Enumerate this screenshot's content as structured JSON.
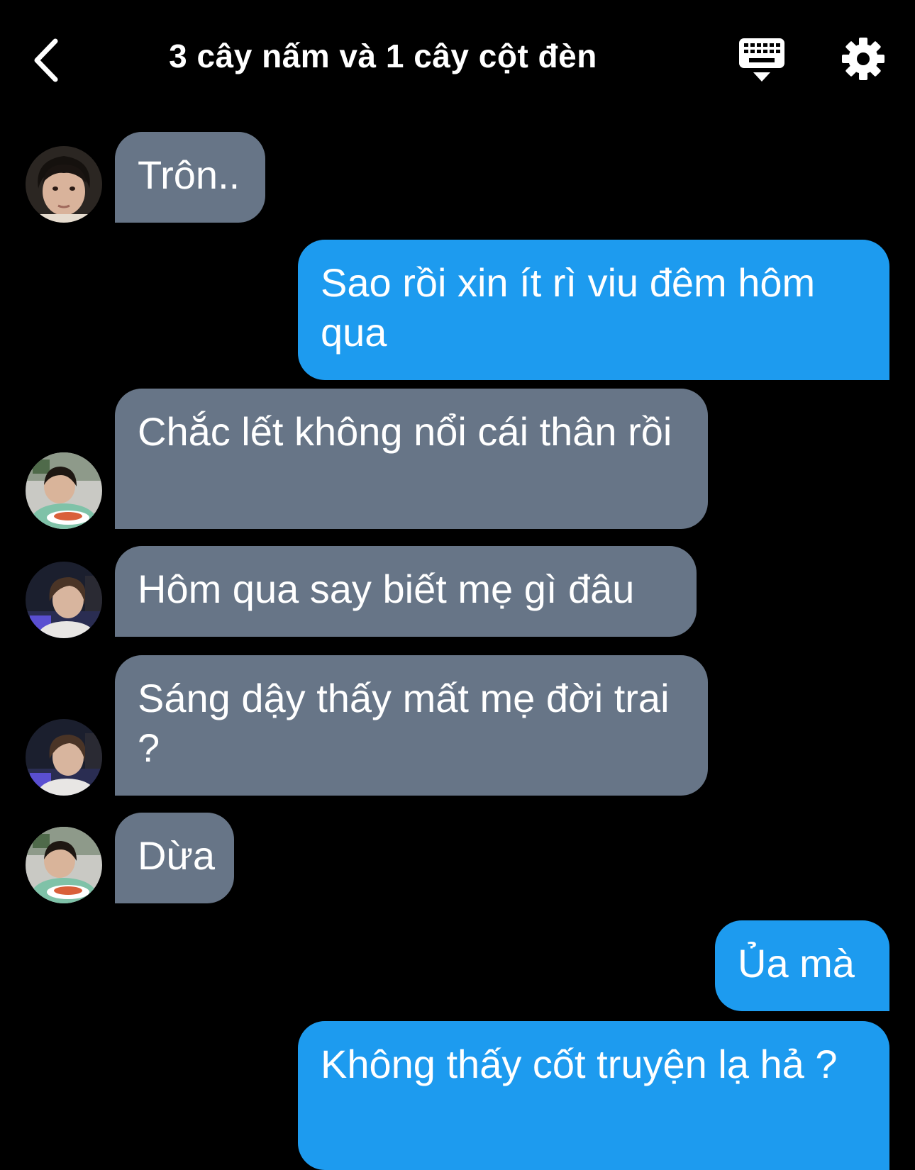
{
  "header": {
    "title": "3 cây nấm và 1 cây cột đèn",
    "back_icon": "chevron-left-icon",
    "keyboard_icon": "keyboard-icon",
    "settings_icon": "gear-icon"
  },
  "colors": {
    "background": "#000000",
    "incoming_bubble": "#677587",
    "outgoing_bubble": "#1d9bef",
    "text": "#ffffff"
  },
  "messages": [
    {
      "direction": "in",
      "text": "Trôn.."
    },
    {
      "direction": "out",
      "text": "Sao rồi xin ít rì viu đêm hôm qua"
    },
    {
      "direction": "in",
      "text": "Chắc lết không nổi cái thân rồi"
    },
    {
      "direction": "in",
      "text": "Hôm qua say biết mẹ gì đâu"
    },
    {
      "direction": "in",
      "text": "Sáng dậy thấy mất mẹ đời trai ?"
    },
    {
      "direction": "in",
      "text": "Dừa"
    },
    {
      "direction": "out",
      "text": "Ủa mà"
    },
    {
      "direction": "out",
      "text": "Không thấy cốt truyện lạ hả ?"
    }
  ]
}
